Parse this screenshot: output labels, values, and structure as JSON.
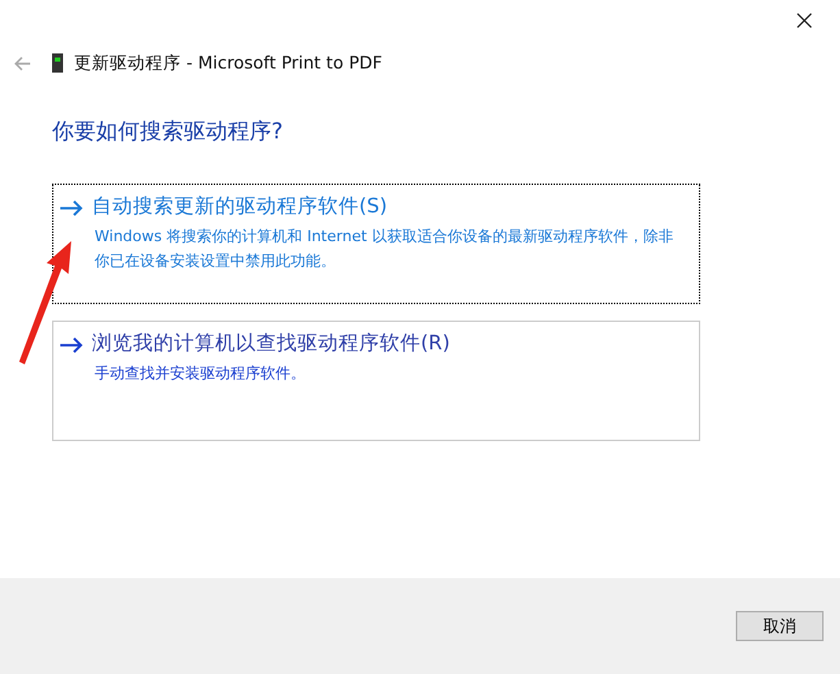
{
  "window": {
    "title": "更新驱动程序 - Microsoft Print to PDF"
  },
  "heading": "你要如何搜索驱动程序?",
  "options": [
    {
      "title": "自动搜索更新的驱动程序软件(S)",
      "description": "Windows 将搜索你的计算机和 Internet 以获取适合你设备的最新驱动程序软件，除非你已在设备安装设置中禁用此功能。",
      "selected": true
    },
    {
      "title": "浏览我的计算机以查找驱动程序软件(R)",
      "description": "手动查找并安装驱动程序软件。",
      "selected": false
    }
  ],
  "buttons": [
    "取消"
  ]
}
